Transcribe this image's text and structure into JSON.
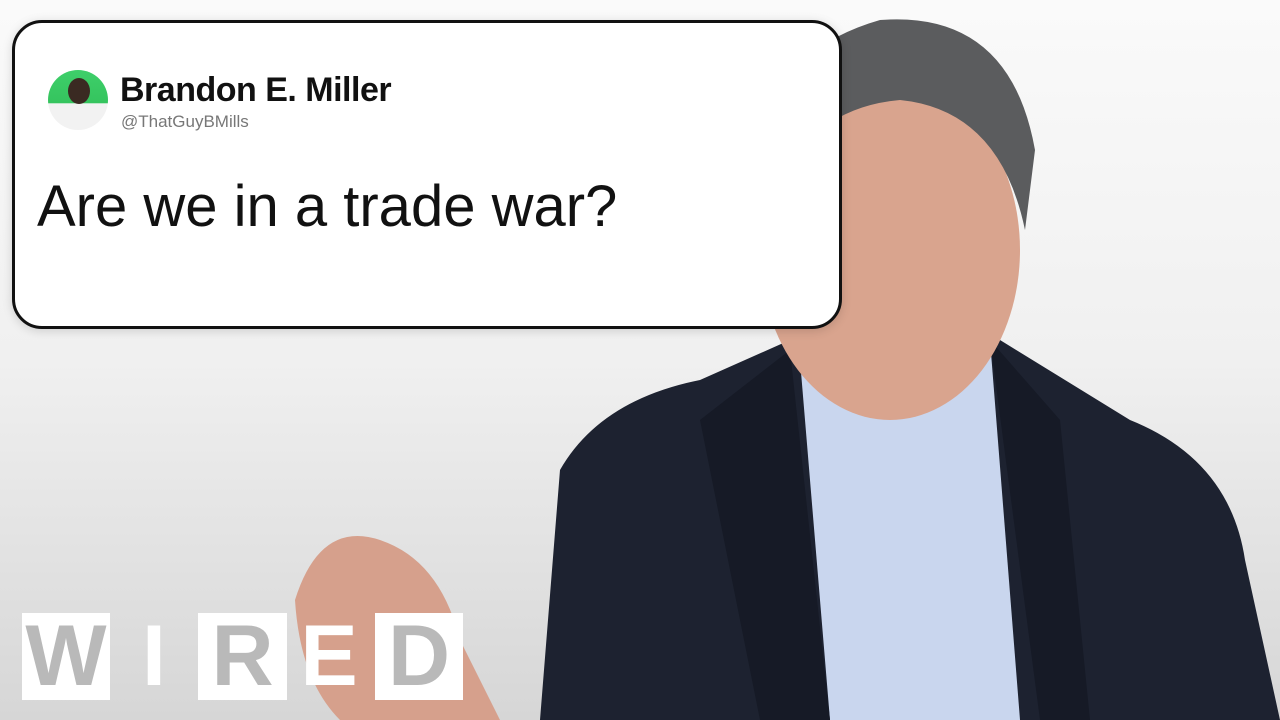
{
  "tweet": {
    "author_name": "Brandon E. Miller",
    "handle": "@ThatGuyBMills",
    "text": "Are we in a trade war?",
    "avatar_color": "#3ecf6a"
  },
  "logo": {
    "letters": [
      "W",
      "I",
      "R",
      "E",
      "D"
    ],
    "text": "WIRED"
  }
}
